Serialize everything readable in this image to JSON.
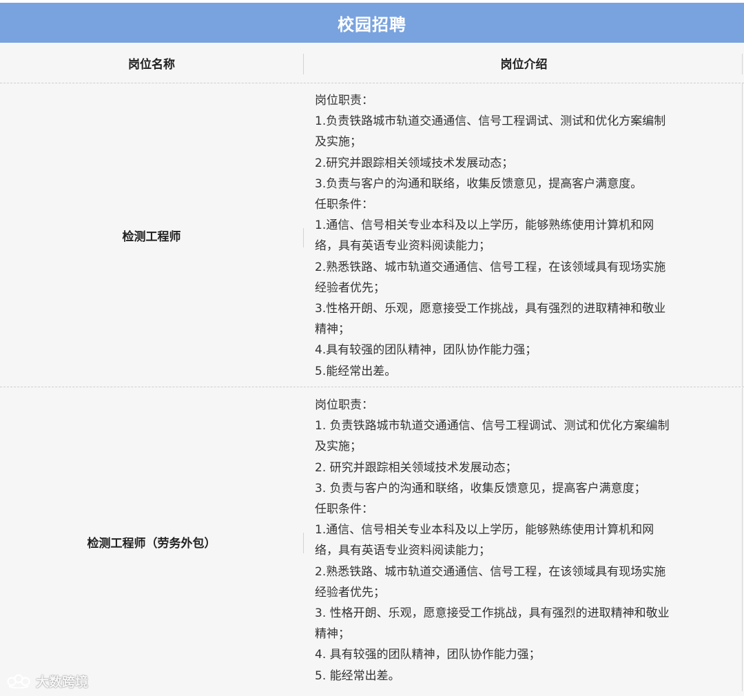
{
  "banner": {
    "title": "校园招聘"
  },
  "table": {
    "headers": [
      "岗位名称",
      "岗位介绍"
    ],
    "rows": [
      {
        "name": "检测工程师",
        "lines": [
          "岗位职责：",
          "1.负责铁路城市轨道交通通信、信号工程调试、测试和优化方案编制",
          "及实施；",
          "2.研究并跟踪相关领域技术发展动态；",
          "3.负责与客户的沟通和联络，收集反馈意见，提高客户满意度。",
          "任职条件：",
          "1.通信、信号相关专业本科及以上学历，能够熟练使用计算机和网",
          "络，具有英语专业资料阅读能力；",
          "2.熟悉铁路、城市轨道交通通信、信号工程，在该领域具有现场实施",
          "经验者优先；",
          "3.性格开朗、乐观，愿意接受工作挑战，具有强烈的进取精神和敬业",
          "精神；",
          "4.具有较强的团队精神，团队协作能力强；",
          "5.能经常出差。"
        ]
      },
      {
        "name": "检测工程师（劳务外包）",
        "lines": [
          "岗位职责：",
          "1. 负责铁路城市轨道交通通信、信号工程调试、测试和优化方案编制",
          "及实施；",
          "2. 研究并跟踪相关领域技术发展动态；",
          "3. 负责与客户的沟通和联络，收集反馈意见，提高客户满意度；",
          "任职条件：",
          "1.通信、信号相关专业本科及以上学历，能够熟练使用计算机和网",
          "络，具有英语专业资料阅读能力；",
          "2.熟悉铁路、城市轨道交通通信、信号工程，在该领域具有现场实施",
          "经验者优先；",
          "3. 性格开朗、乐观，愿意接受工作挑战，具有强烈的进取精神和敬业",
          "精神；",
          "4. 具有较强的团队精神，团队协作能力强；",
          "5. 能经常出差。"
        ]
      }
    ]
  },
  "watermark": {
    "text": "大数跨境",
    "icon": "brand-logo-icon"
  },
  "colors": {
    "banner": "#79a3df",
    "table_bg": "#f6f6f6",
    "divider": "#cfcfcf"
  }
}
